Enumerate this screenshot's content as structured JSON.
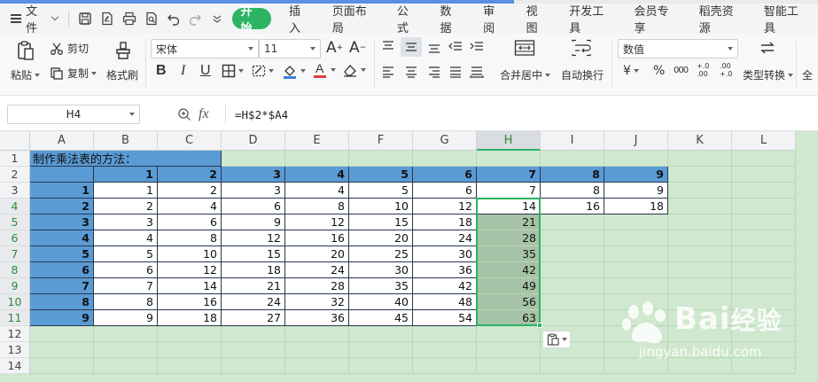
{
  "menubar": {
    "file_label": "文件",
    "tabs": [
      "开始",
      "插入",
      "页面布局",
      "公式",
      "数据",
      "审阅",
      "视图",
      "开发工具",
      "会员专享",
      "稻壳资源",
      "智能工具"
    ],
    "active_tab": "开始"
  },
  "ribbon": {
    "paste_label": "粘贴",
    "cut_label": "剪切",
    "copy_label": "复制",
    "format_painter_label": "格式刷",
    "font_name": "宋体",
    "font_size": "11",
    "merge_label": "合并居中",
    "wrap_label": "自动换行",
    "number_format": "数值",
    "convert_label": "类型转换",
    "truncated_label": "全",
    "currency_symbol": "¥",
    "percent_symbol": "%",
    "thousands_symbol": "000",
    "dec_inc_label": "+.0 .00",
    "dec_dec_label": ".00 +.0"
  },
  "formula_bar": {
    "name_box": "H4",
    "fx_label": "fx",
    "formula": "=H$2*$A4"
  },
  "sheet": {
    "columns": [
      "A",
      "B",
      "C",
      "D",
      "E",
      "F",
      "G",
      "H",
      "I",
      "J",
      "K",
      "L"
    ],
    "rows": [
      "1",
      "2",
      "3",
      "4",
      "5",
      "6",
      "7",
      "8",
      "9",
      "10",
      "11",
      "12",
      "13",
      "14"
    ],
    "title": "制作乘法表的方法：",
    "header_row": [
      "",
      "1",
      "2",
      "3",
      "4",
      "5",
      "6",
      "7",
      "8",
      "9"
    ],
    "table": [
      [
        "1",
        "1",
        "2",
        "3",
        "4",
        "5",
        "6",
        "7",
        "8",
        "9"
      ],
      [
        "2",
        "2",
        "4",
        "6",
        "8",
        "10",
        "12",
        "14",
        "16",
        "18"
      ],
      [
        "3",
        "3",
        "6",
        "9",
        "12",
        "15",
        "18",
        "21",
        "",
        ""
      ],
      [
        "4",
        "4",
        "8",
        "12",
        "16",
        "20",
        "24",
        "28",
        "",
        ""
      ],
      [
        "5",
        "5",
        "10",
        "15",
        "20",
        "25",
        "30",
        "35",
        "",
        ""
      ],
      [
        "6",
        "6",
        "12",
        "18",
        "24",
        "30",
        "36",
        "42",
        "",
        ""
      ],
      [
        "7",
        "7",
        "14",
        "21",
        "28",
        "35",
        "42",
        "49",
        "",
        ""
      ],
      [
        "8",
        "8",
        "16",
        "24",
        "32",
        "40",
        "48",
        "56",
        "",
        ""
      ],
      [
        "9",
        "9",
        "18",
        "27",
        "36",
        "45",
        "54",
        "63",
        "",
        ""
      ]
    ],
    "active_column": "H",
    "selected_rows": [
      "4",
      "5",
      "6",
      "7",
      "8",
      "9",
      "10",
      "11"
    ]
  },
  "watermark": {
    "brand": "Bai",
    "brand2": "经验",
    "url": "jingyan.baidu.com"
  },
  "colors": {
    "accent": "#2db362",
    "sheet_bg": "#cfe8cf",
    "header_fill": "#5b9bd5",
    "highlight_fill": "#a7c3a7"
  }
}
